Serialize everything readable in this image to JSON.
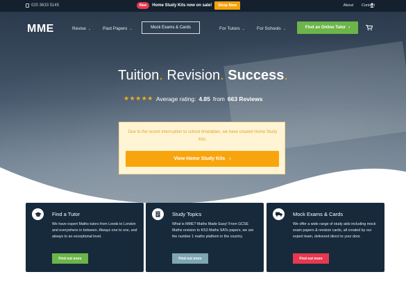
{
  "topbar": {
    "phone": "020 3633 5145",
    "promo_badge": "New",
    "promo_text": "Home Study Kits now on sale!",
    "shop_button": "Shop Now",
    "about": "About",
    "contact": "Contact"
  },
  "nav": {
    "logo": "MME",
    "revise": "Revise",
    "past_papers": "Past Papers",
    "mock_exams": "Mock Exams & Cards",
    "for_tutors": "For Tutors",
    "for_schools": "For Schools",
    "find_tutor": "Find an Online Tutor",
    "chevron": "⌄"
  },
  "hero": {
    "word1": "Tuition",
    "word2": "Revision",
    "word3": "Success",
    "dot": ".",
    "stars": "★★★★★",
    "rating_prefix": "Average rating:",
    "rating_value": "4.85",
    "rating_from": "from",
    "review_count": "663 Reviews"
  },
  "notice": {
    "text": "Due to the recent interruption to school timetables, we have created Home Study Kits.",
    "button": "View Home Study Kits",
    "arrow": "›"
  },
  "cards": [
    {
      "title": "Find a Tutor",
      "desc": "We have expert Maths tutors from Leeds to London and everywhere in between. Always one to one, and always to an exceptional level.",
      "button": "Find out more",
      "button_color": "#6cb549",
      "icon": "graduation-cap-icon"
    },
    {
      "title": "Study Topics",
      "desc": "What is MME? Maths Made Easy! From GCSE Maths revision to KS3 Maths SATs papers, we are the number 1 maths platform in the country.",
      "button": "Find out more",
      "button_color": "#7ea6b4",
      "icon": "document-icon"
    },
    {
      "title": "Mock Exams & Cards",
      "desc": "We offer a wide range of study aids including mock exam papers & revision cards, all created by our expert team, delivered direct to your door.",
      "button": "Find out more",
      "button_color": "#e63950",
      "icon": "delivery-truck-icon"
    }
  ]
}
